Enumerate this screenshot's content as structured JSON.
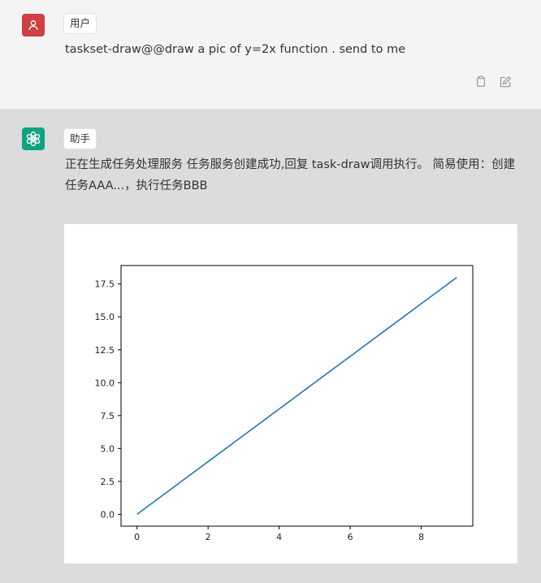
{
  "user_message": {
    "role_label": "用户",
    "text": "taskset-draw@@draw a pic of y=2x function . send to me",
    "actions": [
      "copy-icon",
      "edit-icon"
    ]
  },
  "assistant_message": {
    "role_label": "助手",
    "text": "正在生成任务处理服务 任务服务创建成功,回复 task-draw调用执行。 简易使用：创建任务AAA...，执行任务BBB"
  },
  "chart_data": {
    "type": "line",
    "title": "",
    "xlabel": "",
    "ylabel": "",
    "x": [
      0,
      1,
      2,
      3,
      4,
      5,
      6,
      7,
      8,
      9
    ],
    "series": [
      {
        "values": [
          0,
          2,
          4,
          6,
          8,
          10,
          12,
          14,
          16,
          18
        ],
        "color": "#1f77b4"
      }
    ],
    "xlim": [
      -0.45,
      9.45
    ],
    "ylim": [
      -0.9,
      18.9
    ],
    "xticks": [
      0,
      2,
      4,
      6,
      8
    ],
    "xtick_labels": [
      "0",
      "2",
      "4",
      "6",
      "8"
    ],
    "yticks": [
      0,
      2.5,
      5,
      7.5,
      10,
      12.5,
      15,
      17.5
    ],
    "ytick_labels": [
      "0.0",
      "2.5",
      "5.0",
      "7.5",
      "10.0",
      "12.5",
      "15.0",
      "17.5"
    ],
    "grid": false,
    "legend": "none"
  }
}
